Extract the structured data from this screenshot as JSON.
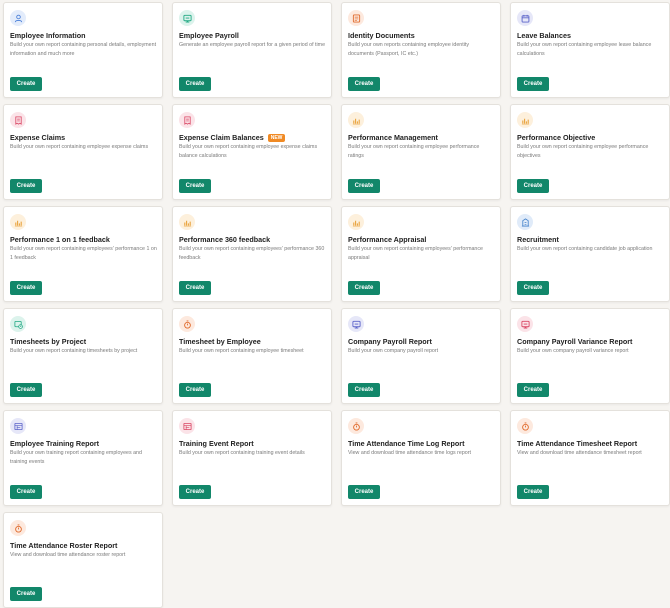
{
  "cards": [
    {
      "title": "Employee Information",
      "description": "Build your own report containing personal details, employment information and much more",
      "button": "Create",
      "icon": "user-icon",
      "color": "#4a7fd8",
      "tint": "c-blue"
    },
    {
      "title": "Employee Payroll",
      "description": "Generate an employee payroll report for a given period of time",
      "button": "Create",
      "icon": "payroll-icon",
      "color": "#1ea882",
      "tint": "c-teal"
    },
    {
      "title": "Identity Documents",
      "description": "Build your own reports containing employee identity documents (Passport, IC etc.)",
      "button": "Create",
      "icon": "id-card-icon",
      "color": "#e06a2c",
      "tint": "c-orange"
    },
    {
      "title": "Leave Balances",
      "description": "Build your own report containing employee leave balance calculations",
      "button": "Create",
      "icon": "calendar-icon",
      "color": "#5b63c9",
      "tint": "c-purple"
    },
    {
      "title": "Expense Claims",
      "description": "Build your own report containing employee expense claims",
      "button": "Create",
      "icon": "receipt-icon",
      "color": "#d94563",
      "tint": "c-pink"
    },
    {
      "title": "Expense Claim Balances",
      "badge": "NEW",
      "description": "Build your own report containing employee expense claims balance calculations",
      "button": "Create",
      "icon": "receipt-icon",
      "color": "#d94563",
      "tint": "c-pink"
    },
    {
      "title": "Performance Management",
      "description": "Build your own report containing employee performance ratings",
      "button": "Create",
      "icon": "bar-chart-icon",
      "color": "#e9a23b",
      "tint": "c-amber"
    },
    {
      "title": "Performance Objective",
      "description": "Build your own report containing employee performance objectives",
      "button": "Create",
      "icon": "bar-chart-icon",
      "color": "#e9a23b",
      "tint": "c-amber"
    },
    {
      "title": "Performance 1 on 1 feedback",
      "description": "Build your own report containing employees' performance 1 on 1 feedback",
      "button": "Create",
      "icon": "bar-chart-icon",
      "color": "#e9a23b",
      "tint": "c-amber"
    },
    {
      "title": "Performance 360 feedback",
      "description": "Build your own report containing employees' performance 360 feedback",
      "button": "Create",
      "icon": "bar-chart-icon",
      "color": "#e9a23b",
      "tint": "c-amber"
    },
    {
      "title": "Performance Appraisal",
      "description": "Build your own report containing employees' performance appraisal",
      "button": "Create",
      "icon": "bar-chart-icon",
      "color": "#e9a23b",
      "tint": "c-amber"
    },
    {
      "title": "Recruitment",
      "description": "Build your own report containing candidate job application",
      "button": "Create",
      "icon": "building-icon",
      "color": "#3f7fc9",
      "tint": "c-lblue"
    },
    {
      "title": "Timesheets by Project",
      "description": "Build your own report containing timesheets by project",
      "button": "Create",
      "icon": "timesheet-icon",
      "color": "#1ea882",
      "tint": "c-teal"
    },
    {
      "title": "Timesheet by Employee",
      "description": "Build your own report containing employee timesheet",
      "button": "Create",
      "icon": "stopwatch-icon",
      "color": "#e06a2c",
      "tint": "c-orange"
    },
    {
      "title": "Company Payroll Report",
      "description": "Build your own company payroll report",
      "button": "Create",
      "icon": "payroll-icon",
      "color": "#5b63c9",
      "tint": "c-purple"
    },
    {
      "title": "Company Payroll Variance Report",
      "description": "Build your own company payroll variance report",
      "button": "Create",
      "icon": "payroll-icon",
      "color": "#d94563",
      "tint": "c-pink"
    },
    {
      "title": "Employee Training Report",
      "description": "Build your own training report containing employees and training events",
      "button": "Create",
      "icon": "training-icon",
      "color": "#5b63c9",
      "tint": "c-purple"
    },
    {
      "title": "Training Event Report",
      "description": "Build your own report containing training event details",
      "button": "Create",
      "icon": "training-icon",
      "color": "#d94563",
      "tint": "c-pink"
    },
    {
      "title": "Time Attendance Time Log Report",
      "description": "View and download time attendance time logs report",
      "button": "Create",
      "icon": "stopwatch-icon",
      "color": "#e06a2c",
      "tint": "c-orange"
    },
    {
      "title": "Time Attendance Timesheet Report",
      "description": "View and download time attendance timesheet report",
      "button": "Create",
      "icon": "stopwatch-icon",
      "color": "#e06a2c",
      "tint": "c-orange"
    },
    {
      "title": "Time Attendance Roster Report",
      "description": "View and download time attendance roster report",
      "button": "Create",
      "icon": "stopwatch-icon",
      "color": "#e06a2c",
      "tint": "c-orange"
    }
  ]
}
